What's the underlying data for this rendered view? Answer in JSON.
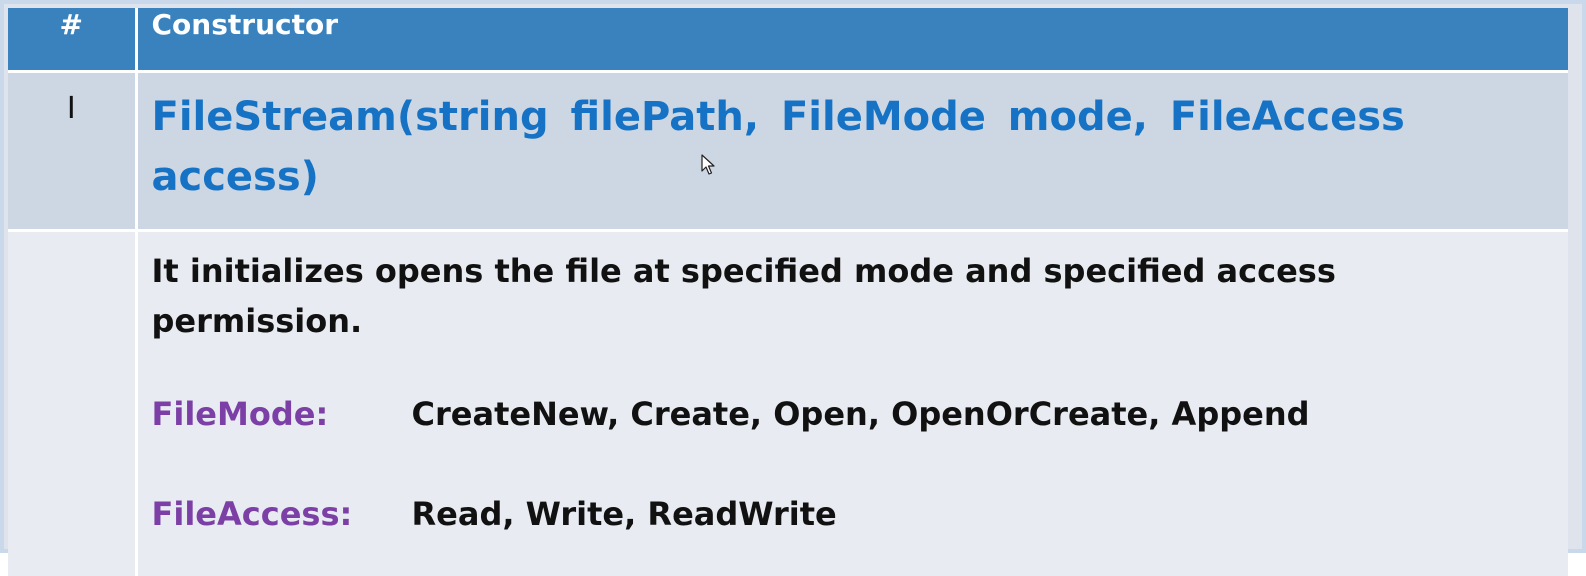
{
  "table": {
    "header": {
      "num": "#",
      "constructor": "Constructor"
    },
    "row": {
      "num": "I",
      "signature": "FileStream(string filePath,  FileMode  mode,  FileAccess access)",
      "description": "It initializes opens the file at specified mode and specified access permission.",
      "params": [
        {
          "name": "FileMode:",
          "values": "CreateNew, Create, Open, OpenOrCreate, Append"
        },
        {
          "name": "FileAccess:",
          "values": "Read, Write, ReadWrite"
        }
      ]
    }
  },
  "colors": {
    "header_bg": "#3a82be",
    "signature_text": "#1672c4",
    "param_label": "#7b3fa6"
  },
  "icons": {
    "cursor": "mouse-pointer-icon"
  }
}
